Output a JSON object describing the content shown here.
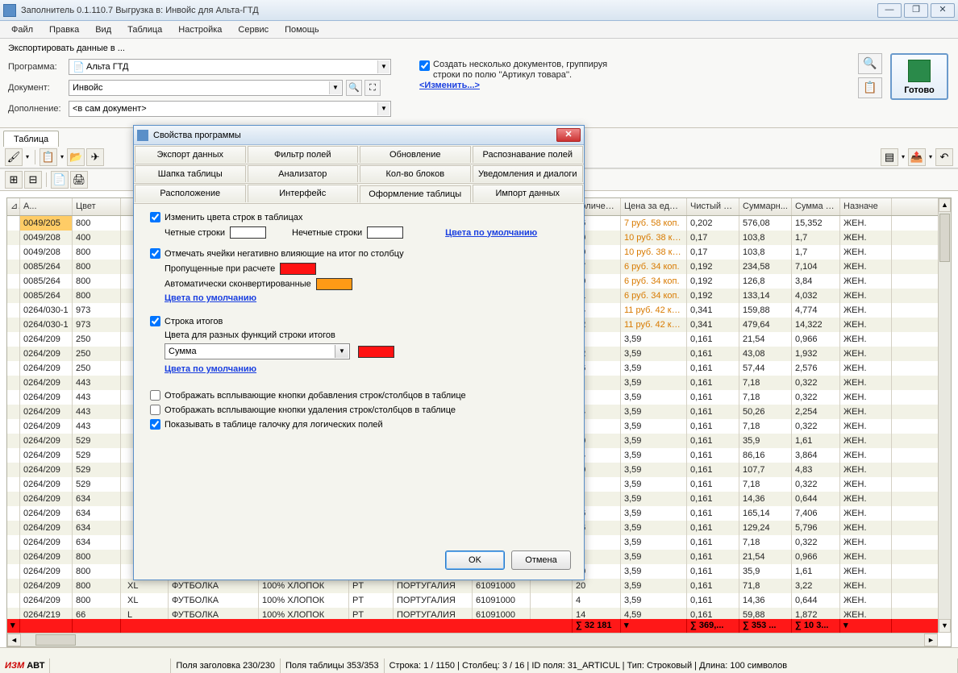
{
  "window": {
    "title": "Заполнитель 0.1.110.7   Выгрузка в: Инвойс для Альта-ГТД"
  },
  "menu": [
    "Файл",
    "Правка",
    "Вид",
    "Таблица",
    "Настройка",
    "Сервис",
    "Помощь"
  ],
  "export_header": "Экспортировать данные в ...",
  "labels": {
    "program": "Программа:",
    "document": "Документ:",
    "addition": "Дополнение:"
  },
  "combo": {
    "program": "Альта ГТД",
    "document": "Инвойс",
    "addition": "<в сам документ>"
  },
  "group": {
    "chk": "Создать несколько документов, группируя строки по полю ''Артикул товара''.",
    "change": "<Изменить...>"
  },
  "ready": "Готово",
  "main_tab": "Таблица",
  "modal": {
    "title": "Свойства программы",
    "tabs_row1": [
      "Экспорт данных",
      "Фильтр полей",
      "Обновление",
      "Распознавание полей"
    ],
    "tabs_row2": [
      "Шапка таблицы",
      "Анализатор",
      "Кол-во блоков",
      "Уведомления и диалоги"
    ],
    "tabs_row3": [
      "Расположение",
      "Интерфейс",
      "Оформление таблицы",
      "Импорт данных"
    ],
    "active_tab": "Оформление таблицы",
    "chk_rowcolors": "Изменить цвета строк в таблицах",
    "even_rows": "Четные строки",
    "odd_rows": "Нечетные строки",
    "defaults_link": "Цвета по умолчанию",
    "chk_negcells": "Отмечать ячейки негативно влияющие на итог по столбцу",
    "skipped": "Пропущенные при расчете",
    "autoconv": "Автоматически сконвертированные",
    "chk_totals": "Строка итогов",
    "totals_funcs_label": "Цвета для разных функций строки итогов",
    "totals_func": "Сумма",
    "chk_addbtns": "Отображать всплывающие кнопки добавления строк/столбцов в таблице",
    "chk_delbtns": "Отображать всплывающие кнопки удаления строк/столбцов в таблице",
    "chk_bools": "Показывать в таблице галочку для логических полей",
    "ok": "OK",
    "cancel": "Отмена",
    "colors": {
      "even": "#ffffff",
      "odd": "#ffffff",
      "skipped": "#ff1212",
      "autoconv": "#ff9a16",
      "totals": "#ff1212"
    }
  },
  "columns": {
    "art": "А...",
    "cv": "Цвет",
    "kol": "Количест...",
    "price": "Цена за един...",
    "net": "Чистый в...",
    "sum": "Суммарн...",
    "sumw": "Сумма ве...",
    "nazn": "Назначе"
  },
  "rows": [
    {
      "art": "0049/205",
      "cv": "800",
      "kol": "76",
      "price": "7 руб. 58 коп.",
      "net": "0,202",
      "sum": "576,08",
      "sumw": "15,352",
      "nazn": "ЖЕН.",
      "p": true
    },
    {
      "art": "0049/208",
      "cv": "400",
      "kol": "10",
      "price": "10 руб. 38 коп.",
      "net": "0,17",
      "sum": "103,8",
      "sumw": "1,7",
      "nazn": "ЖЕН.",
      "p": true
    },
    {
      "art": "0049/208",
      "cv": "800",
      "kol": "10",
      "price": "10 руб. 38 коп.",
      "net": "0,17",
      "sum": "103,8",
      "sumw": "1,7",
      "nazn": "ЖЕН.",
      "p": true
    },
    {
      "art": "0085/264",
      "cv": "800",
      "kol": "37",
      "price": "6 руб. 34 коп.",
      "net": "0,192",
      "sum": "234,58",
      "sumw": "7,104",
      "nazn": "ЖЕН.",
      "p": true
    },
    {
      "art": "0085/264",
      "cv": "800",
      "kol": "20",
      "price": "6 руб. 34 коп.",
      "net": "0,192",
      "sum": "126,8",
      "sumw": "3,84",
      "nazn": "ЖЕН.",
      "p": true
    },
    {
      "art": "0085/264",
      "cv": "800",
      "kol": "21",
      "price": "6 руб. 34 коп.",
      "net": "0,192",
      "sum": "133,14",
      "sumw": "4,032",
      "nazn": "ЖЕН.",
      "p": true
    },
    {
      "art": "0264/030-1",
      "cv": "973",
      "kol": "14",
      "price": "11 руб. 42 коп.",
      "net": "0,341",
      "sum": "159,88",
      "sumw": "4,774",
      "nazn": "ЖЕН.",
      "p": true
    },
    {
      "art": "0264/030-1",
      "cv": "973",
      "kol": "42",
      "price": "11 руб. 42 коп.",
      "net": "0,341",
      "sum": "479,64",
      "sumw": "14,322",
      "nazn": "ЖЕН.",
      "p": true
    },
    {
      "art": "0264/209",
      "cv": "250",
      "kol": "6",
      "price": "3,59",
      "net": "0,161",
      "sum": "21,54",
      "sumw": "0,966",
      "nazn": "ЖЕН."
    },
    {
      "art": "0264/209",
      "cv": "250",
      "kol": "12",
      "price": "3,59",
      "net": "0,161",
      "sum": "43,08",
      "sumw": "1,932",
      "nazn": "ЖЕН."
    },
    {
      "art": "0264/209",
      "cv": "250",
      "kol": "16",
      "price": "3,59",
      "net": "0,161",
      "sum": "57,44",
      "sumw": "2,576",
      "nazn": "ЖЕН."
    },
    {
      "art": "0264/209",
      "cv": "443",
      "kol": "2",
      "price": "3,59",
      "net": "0,161",
      "sum": "7,18",
      "sumw": "0,322",
      "nazn": "ЖЕН."
    },
    {
      "art": "0264/209",
      "cv": "443",
      "kol": "2",
      "price": "3,59",
      "net": "0,161",
      "sum": "7,18",
      "sumw": "0,322",
      "nazn": "ЖЕН."
    },
    {
      "art": "0264/209",
      "cv": "443",
      "kol": "14",
      "price": "3,59",
      "net": "0,161",
      "sum": "50,26",
      "sumw": "2,254",
      "nazn": "ЖЕН."
    },
    {
      "art": "0264/209",
      "cv": "443",
      "kol": "2",
      "price": "3,59",
      "net": "0,161",
      "sum": "7,18",
      "sumw": "0,322",
      "nazn": "ЖЕН."
    },
    {
      "art": "0264/209",
      "cv": "529",
      "kol": "10",
      "price": "3,59",
      "net": "0,161",
      "sum": "35,9",
      "sumw": "1,61",
      "nazn": "ЖЕН."
    },
    {
      "art": "0264/209",
      "cv": "529",
      "kol": "24",
      "price": "3,59",
      "net": "0,161",
      "sum": "86,16",
      "sumw": "3,864",
      "nazn": "ЖЕН."
    },
    {
      "art": "0264/209",
      "cv": "529",
      "kol": "30",
      "price": "3,59",
      "net": "0,161",
      "sum": "107,7",
      "sumw": "4,83",
      "nazn": "ЖЕН."
    },
    {
      "art": "0264/209",
      "cv": "529",
      "kol": "2",
      "price": "3,59",
      "net": "0,161",
      "sum": "7,18",
      "sumw": "0,322",
      "nazn": "ЖЕН."
    },
    {
      "art": "0264/209",
      "cv": "634",
      "kol": "4",
      "price": "3,59",
      "net": "0,161",
      "sum": "14,36",
      "sumw": "0,644",
      "nazn": "ЖЕН."
    },
    {
      "art": "0264/209",
      "cv": "634",
      "kol": "46",
      "price": "3,59",
      "net": "0,161",
      "sum": "165,14",
      "sumw": "7,406",
      "nazn": "ЖЕН."
    },
    {
      "art": "0264/209",
      "cv": "634",
      "kol": "36",
      "price": "3,59",
      "net": "0,161",
      "sum": "129,24",
      "sumw": "5,796",
      "nazn": "ЖЕН."
    },
    {
      "art": "0264/209",
      "cv": "634",
      "kol": "2",
      "price": "3,59",
      "net": "0,161",
      "sum": "7,18",
      "sumw": "0,322",
      "nazn": "ЖЕН."
    },
    {
      "art": "0264/209",
      "cv": "800",
      "kol": "6",
      "price": "3,59",
      "net": "0,161",
      "sum": "21,54",
      "sumw": "0,966",
      "nazn": "ЖЕН."
    },
    {
      "art": "0264/209",
      "cv": "800",
      "kol": "10",
      "price": "3,59",
      "net": "0,161",
      "sum": "35,9",
      "sumw": "1,61",
      "nazn": "ЖЕН."
    },
    {
      "art": "0264/209",
      "cv": "800",
      "razm": "XL",
      "tip": "ФУТБОЛКА",
      "sost": "100% ХЛОПОК",
      "str": "PT",
      "strn": "ПОРТУГАЛИЯ",
      "kod": "61091000",
      "kol": "20",
      "price": "3,59",
      "net": "0,161",
      "sum": "71,8",
      "sumw": "3,22",
      "nazn": "ЖЕН."
    },
    {
      "art": "0264/209",
      "cv": "800",
      "razm": "XL",
      "tip": "ФУТБОЛКА",
      "sost": "100% ХЛОПОК",
      "str": "PT",
      "strn": "ПОРТУГАЛИЯ",
      "kod": "61091000",
      "kol": "4",
      "price": "3,59",
      "net": "0,161",
      "sum": "14,36",
      "sumw": "0,644",
      "nazn": "ЖЕН."
    },
    {
      "art": "0264/219",
      "cv": "66",
      "razm": "L",
      "tip": "ФУТБОЛКА",
      "sost": "100% ХЛОПОК",
      "str": "PT",
      "strn": "ПОРТУГАЛИЯ",
      "kod": "61091000",
      "kol": "14",
      "price": "4,59",
      "net": "0,161",
      "sum": "59,88",
      "sumw": "1,872",
      "nazn": "ЖЕН."
    }
  ],
  "totals": {
    "kol": "∑ 32 181",
    "net": "∑ 369,...",
    "sum": "∑ 353 ...",
    "sumw": "∑ 10 3..."
  },
  "status": {
    "izm": "ИЗМ",
    "avt": "АВТ",
    "header_fields": "Поля заголовка 230/230",
    "table_fields": "Поля таблицы 353/353",
    "rowcol": "Строка: 1 / 1150 | Столбец: 3 / 16 | ID поля: 31_ARTICUL | Тип: Строковый | Длина: 100 символов"
  }
}
